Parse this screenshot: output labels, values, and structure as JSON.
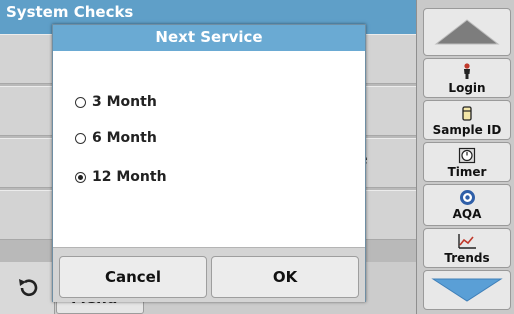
{
  "main": {
    "title": "System Checks",
    "partial_row_text": "e",
    "menu_label": "Menu",
    "back_icon": "back-arrow-icon"
  },
  "sidebar": {
    "scroll_up_icon": "triangle-up-icon",
    "scroll_down_icon": "triangle-down-icon",
    "tools": [
      {
        "label": "Login",
        "icon": "person-icon"
      },
      {
        "label": "Sample ID",
        "icon": "sample-vial-icon"
      },
      {
        "label": "Timer",
        "icon": "timer-icon"
      },
      {
        "label": "AQA",
        "icon": "aqa-icon"
      },
      {
        "label": "Trends",
        "icon": "trend-chart-icon"
      }
    ]
  },
  "dialog": {
    "title": "Next Service",
    "options": [
      {
        "label": "3 Month",
        "selected": false
      },
      {
        "label": "6 Month",
        "selected": false
      },
      {
        "label": "12 Month",
        "selected": true
      }
    ],
    "cancel_label": "Cancel",
    "ok_label": "OK"
  },
  "colors": {
    "header_blue": "#5f9fc8",
    "dialog_title_blue": "#6aaad3",
    "scroll_arrow_blue": "#5a9fd6"
  }
}
